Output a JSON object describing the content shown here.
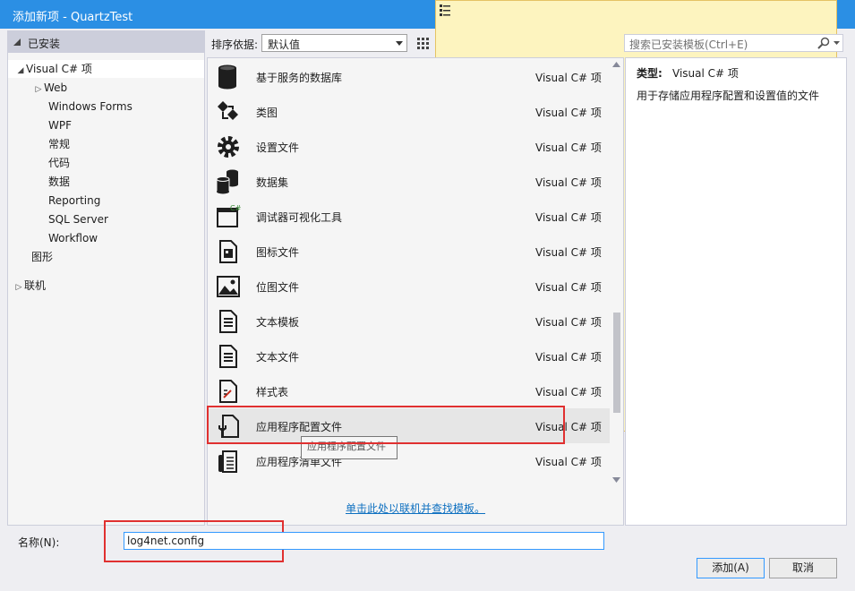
{
  "window": {
    "title": "添加新项 - QuartzTest",
    "help": "?"
  },
  "left": {
    "header": "已安装",
    "tree": [
      {
        "label": "Visual C# 项",
        "caret": "◢"
      },
      {
        "label": "Web",
        "caret": "▷"
      },
      {
        "label": "Windows Forms"
      },
      {
        "label": "WPF"
      },
      {
        "label": "常规"
      },
      {
        "label": "代码"
      },
      {
        "label": "数据"
      },
      {
        "label": "Reporting"
      },
      {
        "label": "SQL Server"
      },
      {
        "label": "Workflow"
      },
      {
        "label": "图形"
      }
    ],
    "online": {
      "label": "联机",
      "caret": "▷"
    }
  },
  "toolbar": {
    "sort_label": "排序依据:",
    "sort_value": "默认值"
  },
  "search": {
    "placeholder": "搜索已安装模板(Ctrl+E)"
  },
  "items": [
    {
      "name": "基于服务的数据库",
      "type": "Visual C# 项",
      "icon": "database-icon"
    },
    {
      "name": "类图",
      "type": "Visual C# 项",
      "icon": "class-diagram-icon"
    },
    {
      "name": "设置文件",
      "type": "Visual C# 项",
      "icon": "gear-icon"
    },
    {
      "name": "数据集",
      "type": "Visual C# 项",
      "icon": "dataset-icon"
    },
    {
      "name": "调试器可视化工具",
      "type": "Visual C# 项",
      "icon": "visualizer-icon"
    },
    {
      "name": "图标文件",
      "type": "Visual C# 项",
      "icon": "icon-file-icon"
    },
    {
      "name": "位图文件",
      "type": "Visual C# 项",
      "icon": "bitmap-icon"
    },
    {
      "name": "文本模板",
      "type": "Visual C# 项",
      "icon": "text-template-icon"
    },
    {
      "name": "文本文件",
      "type": "Visual C# 项",
      "icon": "text-file-icon"
    },
    {
      "name": "样式表",
      "type": "Visual C# 项",
      "icon": "stylesheet-icon"
    },
    {
      "name": "应用程序配置文件",
      "type": "Visual C# 项",
      "icon": "config-file-icon"
    },
    {
      "name": "应用程序清单文件",
      "type": "Visual C# 项",
      "icon": "manifest-icon"
    }
  ],
  "tooltip": "应用程序配置文件",
  "online_link": "单击此处以联机并查找模板。",
  "details": {
    "type_label": "类型:",
    "type_value": "Visual C# 项",
    "description": "用于存储应用程序配置和设置值的文件"
  },
  "bottom": {
    "name_label": "名称(N):",
    "name_value": "log4net.config",
    "add_label": "添加(A)",
    "cancel_label": "取消"
  }
}
